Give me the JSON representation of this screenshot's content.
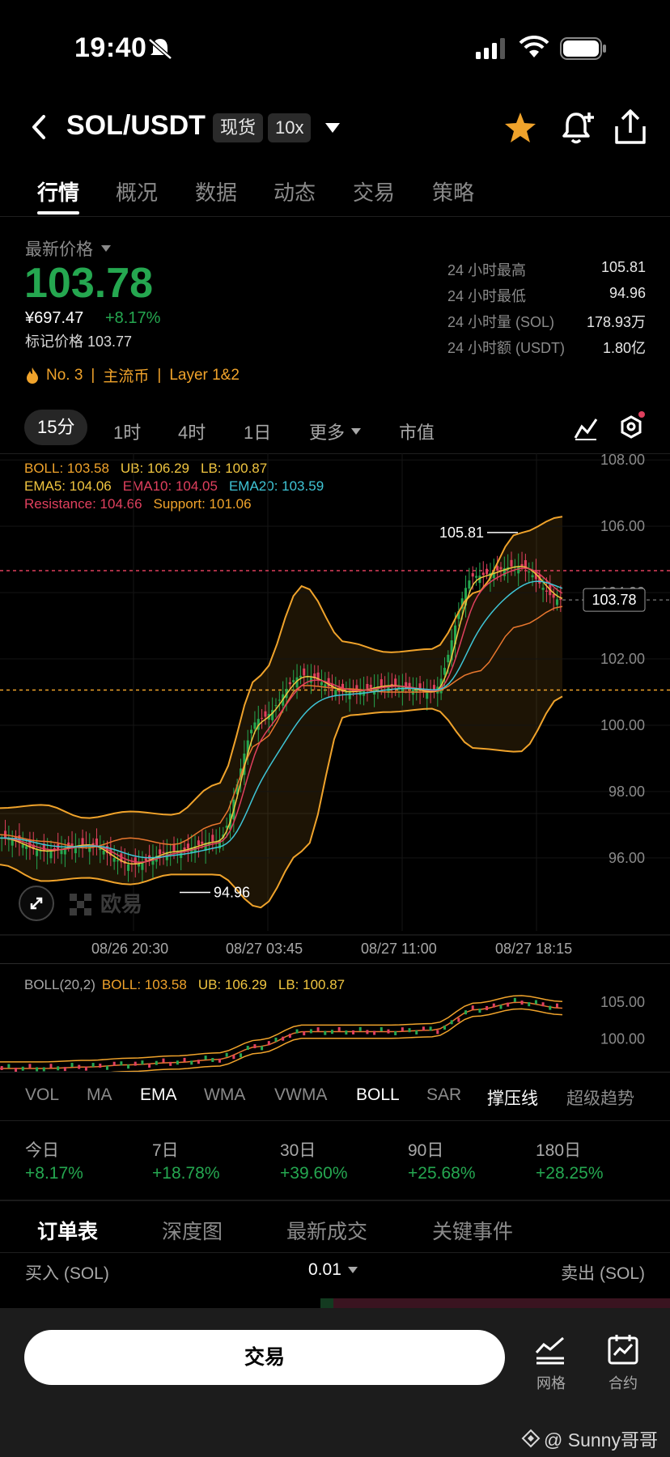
{
  "status_bar": {
    "time": "19:40"
  },
  "header": {
    "pair": "SOL/USDT",
    "tag_spot": "现货",
    "tag_leverage": "10x"
  },
  "tabs": [
    "行情",
    "概况",
    "数据",
    "动态",
    "交易",
    "策略"
  ],
  "price": {
    "last_label": "最新价格",
    "last": "103.78",
    "cny": "¥697.47",
    "change": "+8.17%",
    "mark_label": "标记价格 103.77",
    "rank": "No. 3",
    "category": "主流币",
    "layer": "Layer 1&2"
  },
  "stats": [
    {
      "label": "24 小时最高",
      "value": "105.81"
    },
    {
      "label": "24 小时最低",
      "value": "94.96"
    },
    {
      "label": "24 小时量 (SOL)",
      "value": "178.93万"
    },
    {
      "label": "24 小时额 (USDT)",
      "value": "1.80亿"
    }
  ],
  "timeframes": {
    "active": "15分",
    "t1": "1时",
    "t2": "4时",
    "t3": "1日",
    "more": "更多",
    "mcap": "市值"
  },
  "indicators": {
    "boll": "BOLL: 103.58",
    "ub": "UB: 106.29",
    "lb": "LB: 100.87",
    "ema5": "EMA5: 104.06",
    "ema10": "EMA10: 104.05",
    "ema20": "EMA20: 103.59",
    "resistance": "Resistance: 104.66",
    "support": "Support: 101.06"
  },
  "chart_labels": {
    "y_ticks": [
      "108.00",
      "106.00",
      "104.00",
      "102.00",
      "100.00",
      "98.00",
      "96.00"
    ],
    "x_ticks": [
      "08/26 20:30",
      "08/27 03:45",
      "08/27 11:00",
      "08/27 18:15"
    ],
    "high_marker": "105.81",
    "low_marker": "94.96",
    "current_price_tag": "103.78",
    "watermark": "欧易"
  },
  "subchart": {
    "title": "BOLL(20,2)",
    "boll": "BOLL: 103.58",
    "ub": "UB: 106.29",
    "lb": "LB: 100.87",
    "y_ticks": [
      "105.00",
      "100.00"
    ]
  },
  "indicator_tabs": [
    "VOL",
    "MA",
    "EMA",
    "WMA",
    "VWMA",
    "BOLL",
    "SAR",
    "撑压线",
    "超级趋势"
  ],
  "performance": [
    {
      "label": "今日",
      "value": "+8.17%"
    },
    {
      "label": "7日",
      "value": "+18.78%"
    },
    {
      "label": "30日",
      "value": "+39.60%"
    },
    {
      "label": "90日",
      "value": "+25.68%"
    },
    {
      "label": "180日",
      "value": "+28.25%"
    }
  ],
  "orderbook_tabs": [
    "订单表",
    "深度图",
    "最新成交",
    "关键事件"
  ],
  "orderbook": {
    "buy_label": "买入 (SOL)",
    "precision": "0.01",
    "sell_label": "卖出 (SOL)"
  },
  "bottom": {
    "trade": "交易",
    "grid": "网格",
    "contract": "合约",
    "credit": "@ Sunny哥哥"
  },
  "chart_data": {
    "type": "line",
    "title": "",
    "xlabel": "",
    "ylabel": "",
    "ylim": [
      94,
      108
    ],
    "x": [
      "08/26 20:30",
      "08/27 03:45",
      "08/27 11:00",
      "08/27 18:15"
    ],
    "series": [
      {
        "name": "BOLL",
        "values": [
          96.6,
          96.3,
          97.8,
          101.2,
          101.0,
          102.4,
          103.58
        ]
      },
      {
        "name": "UB",
        "values": [
          97.6,
          97.4,
          99.4,
          104.5,
          102.3,
          105.9,
          106.29
        ]
      },
      {
        "name": "LB",
        "values": [
          95.6,
          95.2,
          95.4,
          97.0,
          100.4,
          99.0,
          100.87
        ]
      }
    ],
    "levels": {
      "resistance": 104.66,
      "support": 101.06,
      "high": 105.81,
      "low": 94.96,
      "last": 103.78
    },
    "colors": {
      "up": "#25a750",
      "down": "#e0405e",
      "boll": "#f0a32b",
      "ema5": "#f0c540",
      "ema10": "#e0405e",
      "ema20": "#3fc5d6",
      "resistance": "#e0405e",
      "support": "#f0a32b"
    }
  }
}
